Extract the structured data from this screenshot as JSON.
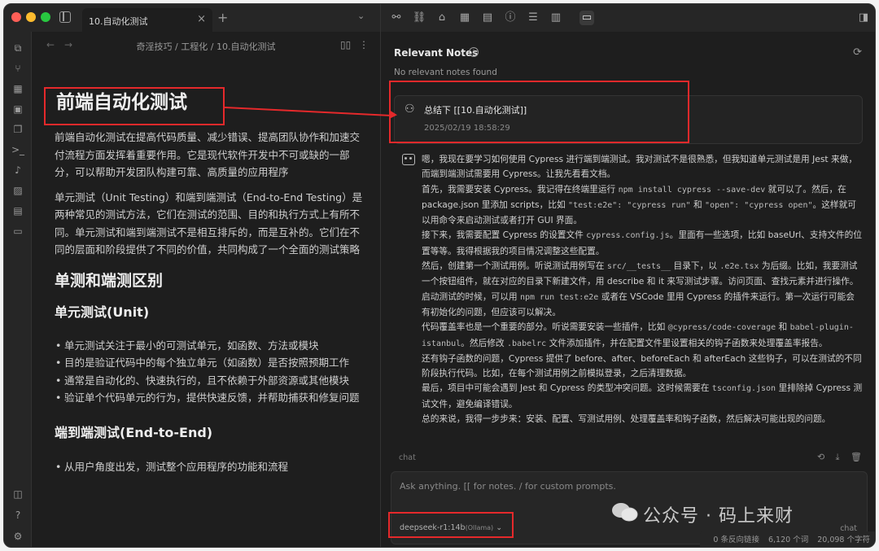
{
  "tab": {
    "title": "10.自动化测试",
    "close": "×",
    "add": "+",
    "menu": "⌄"
  },
  "breadcrumb": "奇淫技巧 / 工程化 / 10.自动化测试",
  "document": {
    "h1": "前端自动化测试",
    "p1": "前端自动化测试在提高代码质量、减少错误、提高团队协作和加速交付流程方面发挥着重要作用。它是现代软件开发中不可或缺的一部分，可以帮助开发团队构建可靠、高质量的应用程序",
    "p2": "单元测试（Unit Testing）和端到端测试（End-to-End Testing）是两种常见的测试方法，它们在测试的范围、目的和执行方式上有所不同。单元测试和端到端测试不是相互排斥的，而是互补的。它们在不同的层面和阶段提供了不同的价值，共同构成了一个全面的测试策略",
    "h2": "单测和端测区别",
    "h3_unit": "单元测试(Unit)",
    "unit_items": [
      "单元测试关注于最小的可测试单元，如函数、方法或模块",
      "目的是验证代码中的每个独立单元（如函数）是否按照预期工作",
      "通常是自动化的、快速执行的，且不依赖于外部资源或其他模块",
      "验证单个代码单元的行为，提供快速反馈，并帮助捕获和修复问题"
    ],
    "h3_e2e": "端到端测试(End-to-End)",
    "e2e_items": [
      "从用户角度出发，测试整个应用程序的功能和流程"
    ]
  },
  "relevant_notes": {
    "title": "Relevant Notes",
    "empty": "No relevant notes found"
  },
  "user_message": {
    "text": "总结下 [[10.自动化测试]]",
    "time": "2025/02/19 18:58:29"
  },
  "assistant": {
    "l1": "嗯，我现在要学习如何使用 Cypress 进行端到端测试。我对测试不是很熟悉，但我知道单元测试是用 Jest 来做，而端到端测试需要用 Cypress。让我先看看文档。",
    "l2a": "首先，我需要安装 Cypress。我记得在终端里运行 ",
    "l2c1": "npm install cypress --save-dev",
    "l2b": " 就可以了。然后，在 package.json 里添加 scripts，比如 ",
    "l2c2": "\"test:e2e\": \"cypress run\"",
    "l2d": " 和 ",
    "l2c3": "\"open\": \"cypress open\"",
    "l2e": "。这样就可以用命令来启动测试或者打开 GUI 界面。",
    "l3a": "接下来，我需要配置 Cypress 的设置文件 ",
    "l3c": "cypress.config.js",
    "l3b": "。里面有一些选项，比如 baseUrl、支持文件的位置等等。我得根据我的项目情况调整这些配置。",
    "l4a": "然后，创建第一个测试用例。听说测试用例写在 ",
    "l4c1": "src/__tests__",
    "l4b": " 目录下，以 ",
    "l4c2": ".e2e.tsx",
    "l4d": " 为后缀。比如，我要测试一个按钮组件，就在对应的目录下新建文件，用 describe 和 it 来写测试步骤。访问页面、查找元素并进行操作。",
    "l5a": "启动测试的时候，可以用 ",
    "l5c": "npm run test:e2e",
    "l5b": " 或者在 VSCode 里用 Cypress 的插件来运行。第一次运行可能会有初始化的问题，但应该可以解决。",
    "l6a": "代码覆盖率也是一个重要的部分。听说需要安装一些插件，比如 ",
    "l6c1": "@cypress/code-coverage",
    "l6b": " 和 ",
    "l6c2": "babel-plugin-istanbul",
    "l6d": "。然后修改 ",
    "l6c3": ".babelrc",
    "l6e": " 文件添加插件，并在配置文件里设置相关的钩子函数来处理覆盖率报告。",
    "l7": "还有钩子函数的问题，Cypress 提供了 before、after、beforeEach 和 afterEach 这些钩子，可以在测试的不同阶段执行代码。比如，在每个测试用例之前模拟登录，之后清理数据。",
    "l8a": "最后，项目中可能会遇到 Jest 和 Cypress 的类型冲突问题。这时候需要在 ",
    "l8c": "tsconfig.json",
    "l8b": " 里排除掉 Cypress 测试文件，避免编译错误。",
    "l9": "总的来说，我得一步步来：安装、配置、写测试用例、处理覆盖率和钩子函数，然后解决可能出现的问题。"
  },
  "chat_label": "chat",
  "input": {
    "placeholder": "Ask anything. [[ for notes. / for custom prompts.",
    "model": "deepseek-r1:14b",
    "provider": "(Ollama)",
    "send": "chat"
  },
  "status": {
    "backlinks": "0 条反向链接",
    "words": "6,120 个词",
    "chars": "20,098 个字符"
  },
  "watermark": "公众号 · 码上来财"
}
